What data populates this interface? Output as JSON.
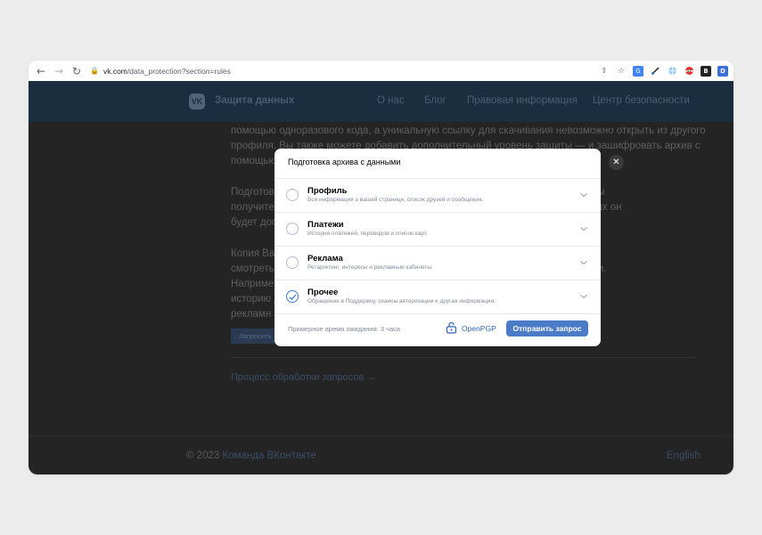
{
  "browser": {
    "url_host": "vk.com",
    "url_path": "/data_protection?section=rules",
    "back_glyph": "←",
    "forward_glyph": "→",
    "reload_glyph": "↻",
    "lock_glyph": "🔒",
    "share_glyph": "⇪",
    "bookmark_glyph": "☆",
    "extensions": [
      "translate-icon",
      "brush-icon",
      "globe-icon",
      "puzzle-icon",
      "vpn-icon",
      "bitwarden-icon",
      "bookmark-manager-icon"
    ]
  },
  "site": {
    "logo_text": "VK",
    "title": "Защита данных",
    "nav": [
      "О нас",
      "Блог",
      "Правовая информация",
      "Центр безопасности"
    ]
  },
  "page": {
    "para1_lines": [
      "помощью одноразового кода, а уникальную ссылку для скачивания невозможно открыть из другого",
      "профиля. Вы также можете добавить дополнительный уровень защиты — и зашифровать архив с",
      "помощью"
    ],
    "para2_lines": [
      "Подготов                                                                                     есколько дней. Вы",
      "получите                                                                                      сти Ваших данных он",
      "будет дос"
    ],
    "para3_lines": [
      "Копия Ва                                                                                     данные удобнее",
      "смотреть                                                                                      разные категории.",
      "Наприме                                                                                     ку «Нравится»,",
      "историю д                                                                                     при таргетинге",
      "рекламн"
    ],
    "request_button": "Запросить",
    "process_link": "Процесс обработки запросов →",
    "copyright": "© 2023",
    "team": "Команда ВКонтакте",
    "english": "English"
  },
  "modal": {
    "title": "Подготовка архива с данными",
    "options": [
      {
        "title": "Профиль",
        "subtitle": "Вся информация о вашей странице, список друзей и сообщения.",
        "checked": false
      },
      {
        "title": "Платежи",
        "subtitle": "История платежей, переводов и список карт.",
        "checked": false
      },
      {
        "title": "Реклама",
        "subtitle": "Ретаргетинг, интересы и рекламные кабинеты.",
        "checked": false
      },
      {
        "title": "Прочее",
        "subtitle": "Обращения в Поддержку, сеансы авторизации и другая информация.",
        "checked": true
      }
    ],
    "wait_text": "Примерное время ожидания: 3 часа",
    "openpgp_label": "OpenPGP",
    "send_button": "Отправить запрос",
    "close_glyph": "✕"
  },
  "colors": {
    "header_bg": "#1b2e3f",
    "accent": "#4a7bc6",
    "link": "#2d64bc"
  }
}
